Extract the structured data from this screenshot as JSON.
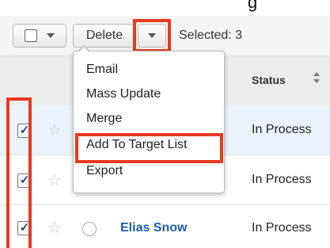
{
  "top_caption": "g",
  "toolbar": {
    "delete_label": "Delete",
    "selected_text": "Selected: 3"
  },
  "table": {
    "status_header": "Status"
  },
  "menu": {
    "items": [
      "Email",
      "Mass Update",
      "Merge",
      "Add To Target List",
      "Export"
    ]
  },
  "rows": [
    {
      "name": "",
      "status": "In Process",
      "checked": true
    },
    {
      "name": "",
      "status": "In Process",
      "checked": true
    },
    {
      "name": "Elias Snow",
      "status": "In Process",
      "checked": true
    }
  ],
  "colors": {
    "highlight": "#e8391e",
    "link": "#1d5ea8"
  }
}
